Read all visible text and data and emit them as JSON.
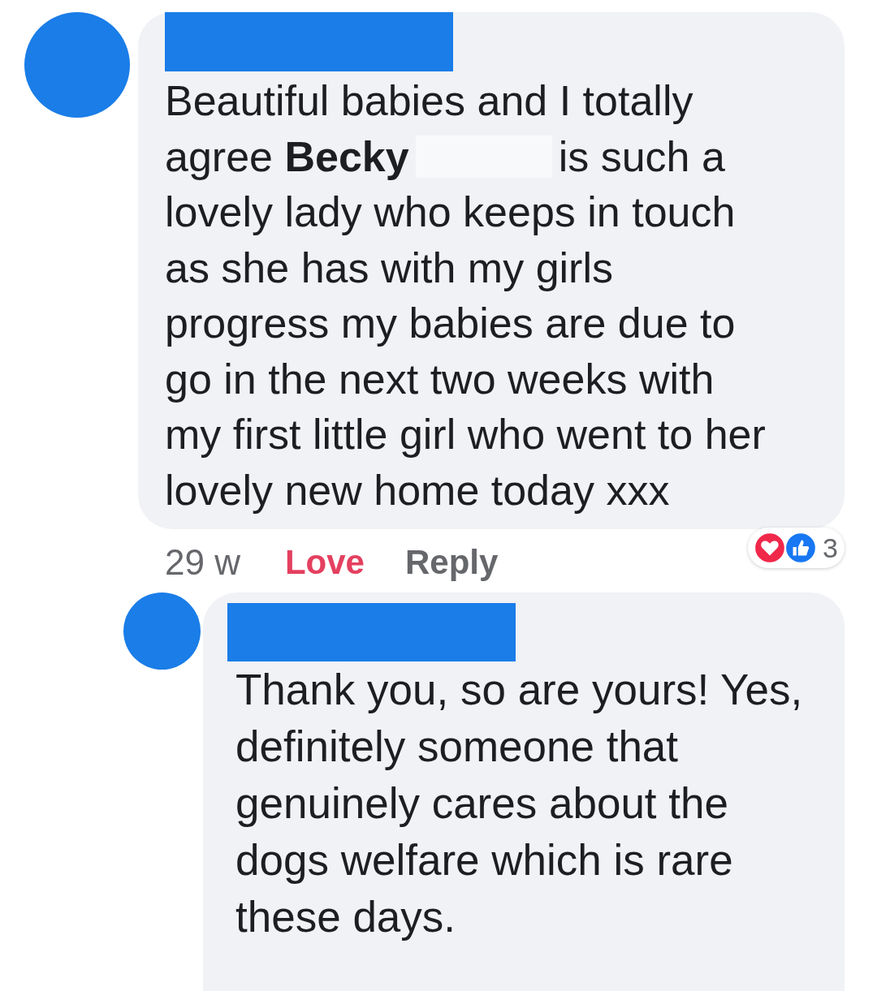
{
  "comments": [
    {
      "lines": [
        {
          "text": "Beautiful babies and I totally"
        },
        {
          "text": "agree **Becky**",
          "after_redaction": "is such a"
        },
        {
          "text": "lovely lady who keeps in touch"
        },
        {
          "text": "as she has with my girls"
        },
        {
          "text": "progress my babies are due to"
        },
        {
          "text": "go in the next two weeks with"
        },
        {
          "text": "my first little girl who went to her"
        },
        {
          "text": "lovely new home today xxx"
        }
      ],
      "time": "29 w",
      "actions": [
        {
          "label": "Love",
          "selected": true
        },
        {
          "label": "Reply",
          "selected": false
        }
      ],
      "reactions": {
        "types": [
          {
            "kind": "love"
          },
          {
            "kind": "like"
          }
        ],
        "count": "3"
      }
    },
    {
      "lines": [
        {
          "text": "Thank you, so are yours! Yes,"
        },
        {
          "text": "definitely someone that"
        },
        {
          "text": "genuinely cares about the"
        },
        {
          "text": "dogs welfare which is rare"
        },
        {
          "text": "these days."
        }
      ]
    }
  ]
}
